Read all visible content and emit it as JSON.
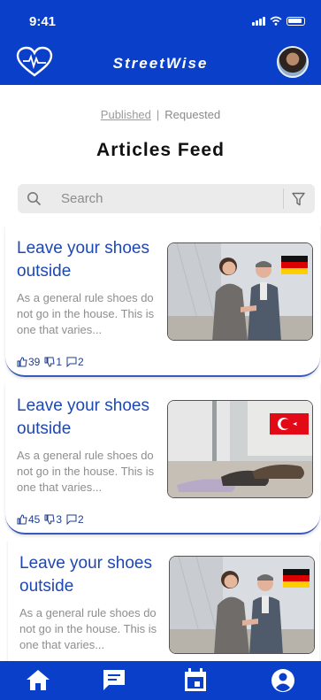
{
  "status": {
    "time": "9:41"
  },
  "header": {
    "app_title": "StreetWise"
  },
  "tabs": {
    "published": "Published",
    "separator": "|",
    "requested": "Requested"
  },
  "page_title": "Articles Feed",
  "search": {
    "placeholder": "Search"
  },
  "articles": [
    {
      "title": "Leave your shoes outside",
      "description": "As a general rule shoes do not go in the house. This is one that varies...",
      "likes": "39",
      "dislikes": "1",
      "comments": "2",
      "flag": "germany",
      "image": "business-handshake"
    },
    {
      "title": "Leave your shoes outside",
      "description": "As a general rule shoes do not go in the house. This is one that varies...",
      "likes": "45",
      "dislikes": "3",
      "comments": "2",
      "flag": "turkey",
      "image": "shoes-on-floor"
    },
    {
      "title": "Leave your shoes outside",
      "description": "As a general rule shoes do not go in the house. This is one that varies...",
      "flag": "germany",
      "image": "business-handshake"
    }
  ],
  "nav": [
    "home-icon",
    "feed-icon",
    "calendar-icon",
    "profile-icon"
  ],
  "colors": {
    "brand": "#0a3fc9",
    "title": "#1d47b3"
  }
}
